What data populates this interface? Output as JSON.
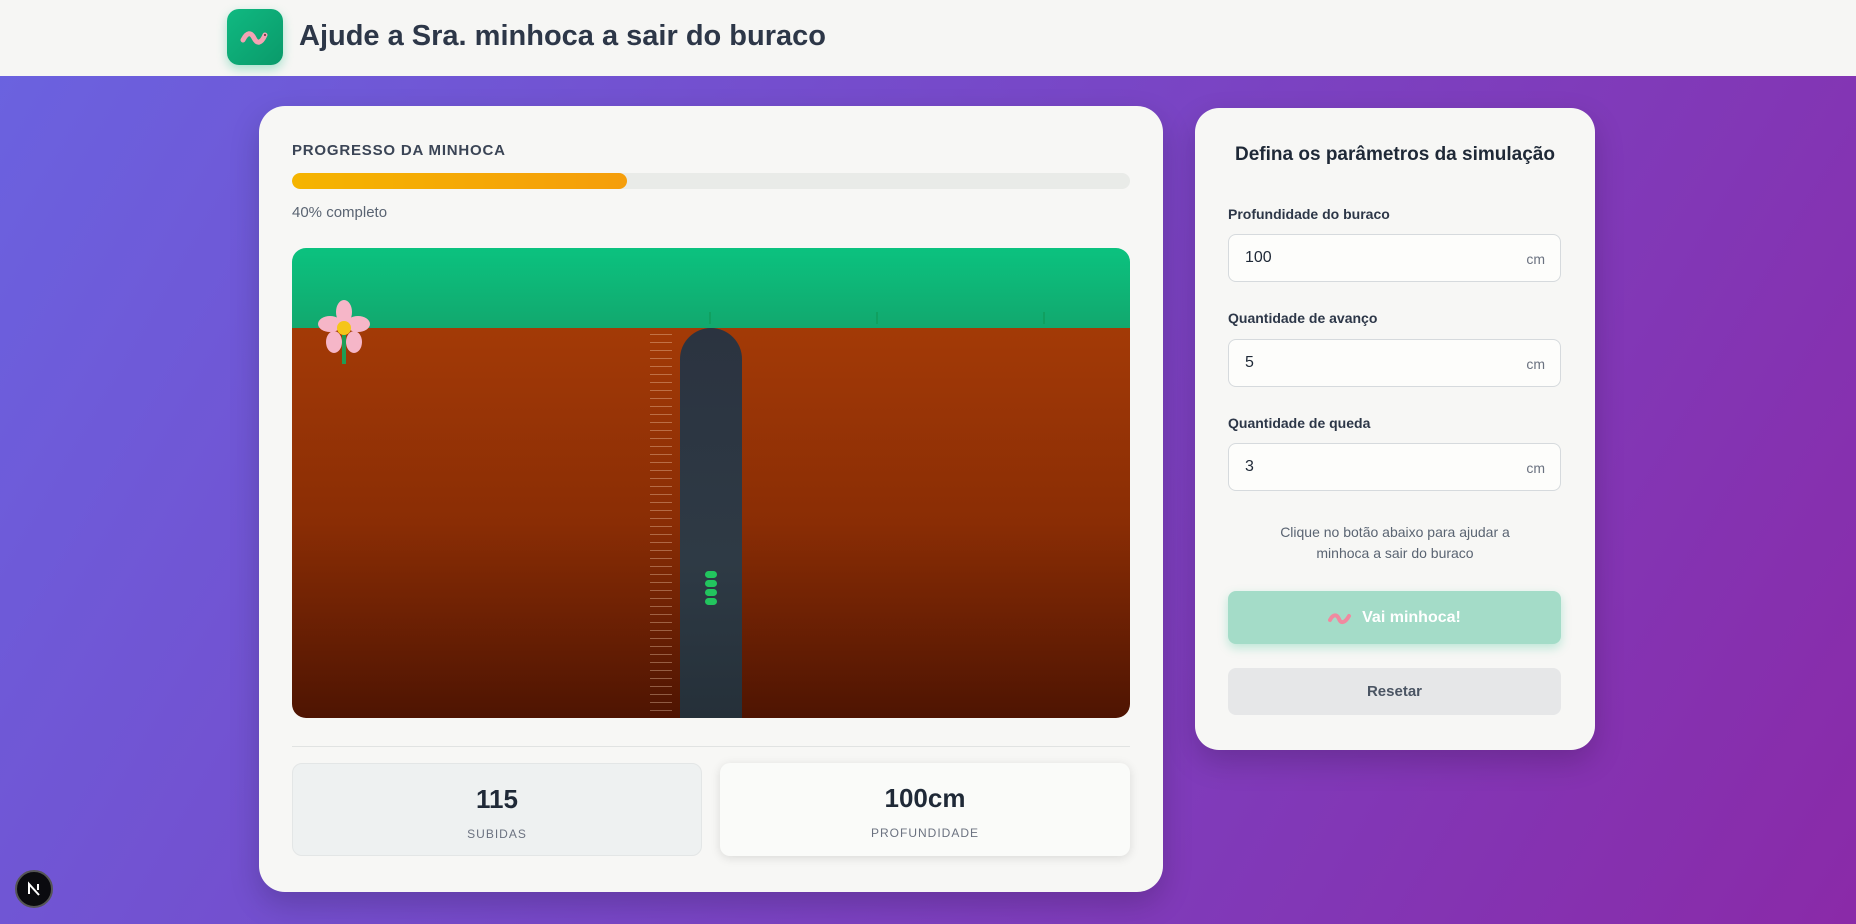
{
  "header": {
    "title": "Ajude a Sra. minhoca a sair do buraco",
    "logo_icon": "worm-icon"
  },
  "progress": {
    "label": "PROGRESSO DA MINHOCA",
    "value_percent": 40,
    "text": "40% completo"
  },
  "scene": {
    "decorations": [
      "flower-icon",
      "grass-sprout",
      "depth-ruler",
      "worm-hole"
    ],
    "worm_position_fraction": 0.4
  },
  "stats": {
    "climbs": {
      "value": "115",
      "label": "SUBIDAS"
    },
    "depth": {
      "value": "100cm",
      "label": "PROFUNDIDADE"
    }
  },
  "panel": {
    "title": "Defina os parâmetros da simulação",
    "fields": [
      {
        "label": "Profundidade do buraco",
        "value": "100",
        "unit": "cm"
      },
      {
        "label": "Quantidade de avanço",
        "value": "5",
        "unit": "cm"
      },
      {
        "label": "Quantidade de queda",
        "value": "3",
        "unit": "cm"
      }
    ],
    "hint": "Clique no botão abaixo para ajudar a minhoca a sair do buraco",
    "go_button": "Vai minhoca!",
    "reset_button": "Resetar"
  },
  "colors": {
    "accent_green": "#10b981",
    "progress_yellow": "#f5b400",
    "soil": "#a33a06",
    "background_start": "#6a63e0",
    "background_end": "#8a2aa8"
  }
}
